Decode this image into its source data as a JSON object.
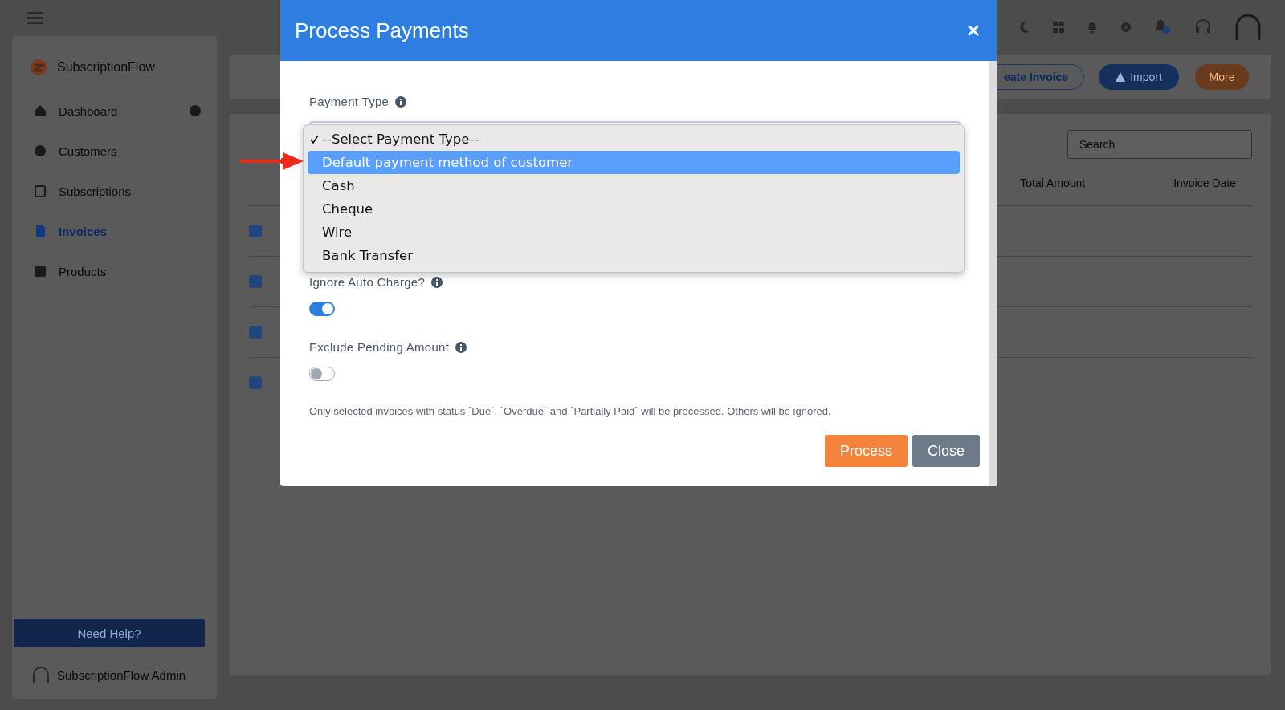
{
  "sidebar": {
    "brand": "SubscriptionFlow",
    "items": [
      {
        "label": "Dashboard",
        "badge": true,
        "selected": false
      },
      {
        "label": "Customers",
        "badge": false,
        "selected": false
      },
      {
        "label": "Subscriptions",
        "badge": false,
        "selected": false
      },
      {
        "label": "Invoices",
        "badge": false,
        "selected": true
      },
      {
        "label": "Products",
        "badge": false,
        "selected": false
      }
    ],
    "help_button": "Need Help?",
    "user": "SubscriptionFlow Admin"
  },
  "toolbar": {
    "buttons": [
      {
        "label": "eate Invoice",
        "kind": "outline"
      },
      {
        "label": "Import",
        "kind": "primary"
      },
      {
        "label": "More",
        "kind": "accent"
      }
    ]
  },
  "table": {
    "search_placeholder": "Search",
    "columns": [
      "Total Amount",
      "Invoice Date"
    ],
    "rows": [
      {
        "checked": true
      },
      {
        "checked": true
      },
      {
        "checked": true
      },
      {
        "checked": true
      }
    ]
  },
  "modal": {
    "title": "Process Payments",
    "payment_type": {
      "label": "Payment Type",
      "options": [
        {
          "label": "--Select Payment Type--",
          "checked": true,
          "selected": false
        },
        {
          "label": "Default payment method of customer",
          "checked": false,
          "selected": true
        },
        {
          "label": "Cash",
          "checked": false,
          "selected": false
        },
        {
          "label": "Cheque",
          "checked": false,
          "selected": false
        },
        {
          "label": "Wire",
          "checked": false,
          "selected": false
        },
        {
          "label": "Bank Transfer",
          "checked": false,
          "selected": false
        }
      ]
    },
    "toggles": [
      {
        "label": "Ignore Auto Charge?",
        "on": true
      },
      {
        "label": "Exclude Pending Amount",
        "on": false
      }
    ],
    "note": "Only selected invoices with status `Due`, `Overdue` and `Partially Paid` will be processed. Others will be ignored.",
    "buttons": [
      {
        "label": "Process",
        "kind": "primary"
      },
      {
        "label": "Close",
        "kind": "secondary"
      }
    ]
  }
}
